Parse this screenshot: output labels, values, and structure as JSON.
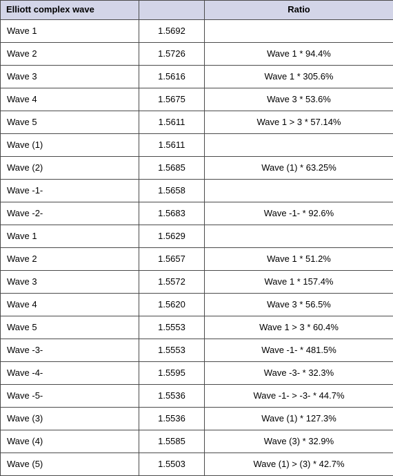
{
  "table": {
    "columns": [
      {
        "key": "wave",
        "label": "Elliott complex wave",
        "align": "left"
      },
      {
        "key": "value",
        "label": "",
        "align": "center"
      },
      {
        "key": "ratio",
        "label": "Ratio",
        "align": "center"
      }
    ],
    "highlight_color": "#c2d9e8",
    "header_color": "#d3d5e8",
    "border_color": "#4a4a4a",
    "rows": [
      {
        "wave": "Wave 1",
        "value": "1.5692",
        "ratio": "",
        "highlighted": false
      },
      {
        "wave": "Wave 2",
        "value": "1.5726",
        "ratio": "Wave 1 * 94.4%",
        "highlighted": false
      },
      {
        "wave": "Wave 3",
        "value": "1.5616",
        "ratio": "Wave 1 * 305.6%",
        "highlighted": true
      },
      {
        "wave": "Wave 4",
        "value": "1.5675",
        "ratio": "Wave 3 * 53.6%",
        "highlighted": false
      },
      {
        "wave": "Wave 5",
        "value": "1.5611",
        "ratio": "Wave 1 > 3 * 57.14%",
        "highlighted": true
      },
      {
        "wave": "Wave (1)",
        "value": "1.5611",
        "ratio": "",
        "highlighted": false
      },
      {
        "wave": "Wave (2)",
        "value": "1.5685",
        "ratio": "Wave (1) * 63.25%",
        "highlighted": false
      },
      {
        "wave": "Wave -1-",
        "value": "1.5658",
        "ratio": "",
        "highlighted": false
      },
      {
        "wave": "Wave -2-",
        "value": "1.5683",
        "ratio": "Wave -1- * 92.6%",
        "highlighted": false
      },
      {
        "wave": "Wave 1",
        "value": "1.5629",
        "ratio": "",
        "highlighted": false
      },
      {
        "wave": "Wave 2",
        "value": "1.5657",
        "ratio": "Wave 1 * 51.2%",
        "highlighted": false
      },
      {
        "wave": "Wave 3",
        "value": "1.5572",
        "ratio": "Wave 1 * 157.4%",
        "highlighted": true
      },
      {
        "wave": "Wave 4",
        "value": "1.5620",
        "ratio": "Wave 3 * 56.5%",
        "highlighted": false
      },
      {
        "wave": "Wave 5",
        "value": "1.5553",
        "ratio": "Wave 1 > 3 * 60.4%",
        "highlighted": false
      },
      {
        "wave": "Wave -3-",
        "value": "1.5553",
        "ratio": "Wave -1- * 481.5%",
        "highlighted": false
      },
      {
        "wave": "Wave -4-",
        "value": "1.5595",
        "ratio": "Wave -3- * 32.3%",
        "highlighted": false
      },
      {
        "wave": "Wave -5-",
        "value": "1.5536",
        "ratio": "Wave -1- > -3- * 44.7%",
        "highlighted": true
      },
      {
        "wave": "Wave (3)",
        "value": "1.5536",
        "ratio": "Wave (1) * 127.3%",
        "highlighted": true
      },
      {
        "wave": "Wave (4)",
        "value": "1.5585",
        "ratio": "Wave (3) * 32.9%",
        "highlighted": false
      },
      {
        "wave": "Wave (5)",
        "value": "1.5503",
        "ratio": "Wave (1) > (3) * 42.7%",
        "highlighted": true
      }
    ]
  }
}
